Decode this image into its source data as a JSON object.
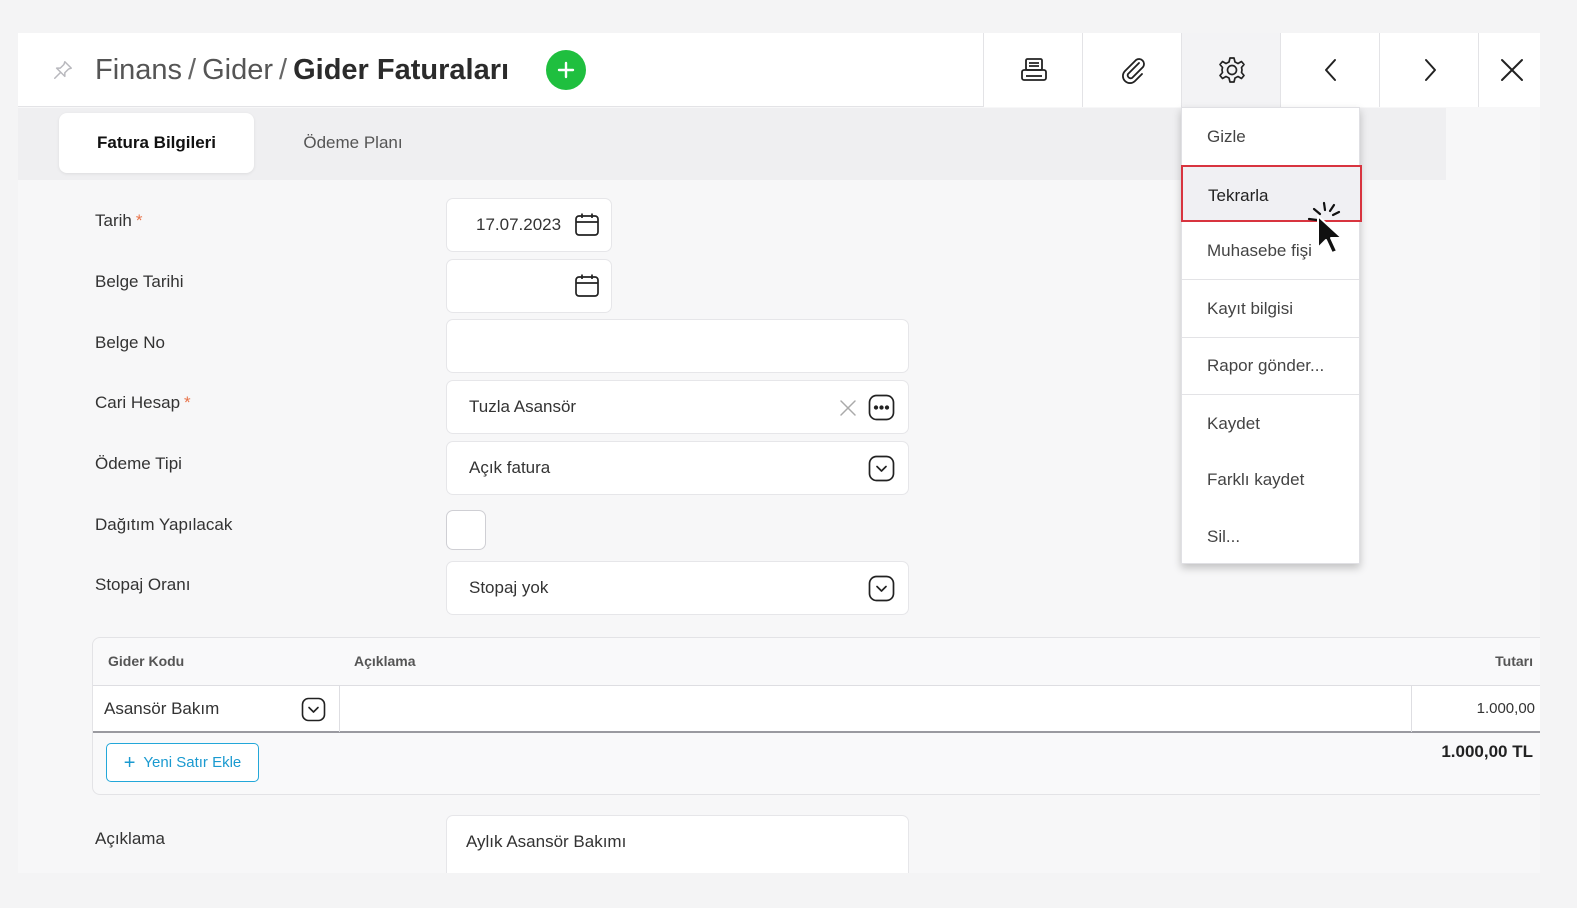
{
  "header": {
    "breadcrumb": [
      "Finans",
      "Gider"
    ],
    "title": "Gider Faturaları"
  },
  "tabs": [
    {
      "label": "Fatura Bilgileri",
      "active": true
    },
    {
      "label": "Ödeme Planı",
      "active": false
    }
  ],
  "form": {
    "tarih": {
      "label": "Tarih",
      "required": "*",
      "value": "17.07.2023"
    },
    "belge_tarihi": {
      "label": "Belge Tarihi",
      "value": ""
    },
    "belge_no": {
      "label": "Belge No",
      "value": ""
    },
    "cari_hesap": {
      "label": "Cari Hesap",
      "required": "*",
      "value": "Tuzla Asansör"
    },
    "odeme_tipi": {
      "label": "Ödeme Tipi",
      "value": "Açık fatura"
    },
    "dagitim": {
      "label": "Dağıtım Yapılacak",
      "checked": false
    },
    "stopaj": {
      "label": "Stopaj Oranı",
      "value": "Stopaj yok"
    },
    "aciklama": {
      "label": "Açıklama",
      "value": "Aylık Asansör Bakımı"
    }
  },
  "grid": {
    "columns": [
      "Gider Kodu",
      "Açıklama",
      "Tutarı"
    ],
    "rows": [
      {
        "gider_kodu": "Asansör Bakım",
        "aciklama": "",
        "tutar": "1.000,00"
      }
    ],
    "new_row_label": "Yeni Satır Ekle",
    "total": "1.000,00 TL"
  },
  "menu": {
    "items": [
      "Gizle",
      "Tekrarla",
      "Muhasebe fişi",
      "Kayıt bilgisi",
      "Rapor gönder...",
      "Kaydet",
      "Farklı kaydet",
      "Sil..."
    ],
    "highlighted": "Tekrarla"
  },
  "colors": {
    "accent_green": "#1fbf3f",
    "link_blue": "#23a7d9",
    "highlight_red": "#d8343f",
    "required_orange": "#e8734a"
  },
  "icons": [
    "pin-icon",
    "plus-icon",
    "printer-icon",
    "paperclip-icon",
    "gear-icon",
    "chevron-left-icon",
    "chevron-right-icon",
    "close-icon",
    "calendar-icon",
    "clear-icon",
    "ellipsis-icon",
    "chevron-down-icon",
    "cursor-icon"
  ]
}
